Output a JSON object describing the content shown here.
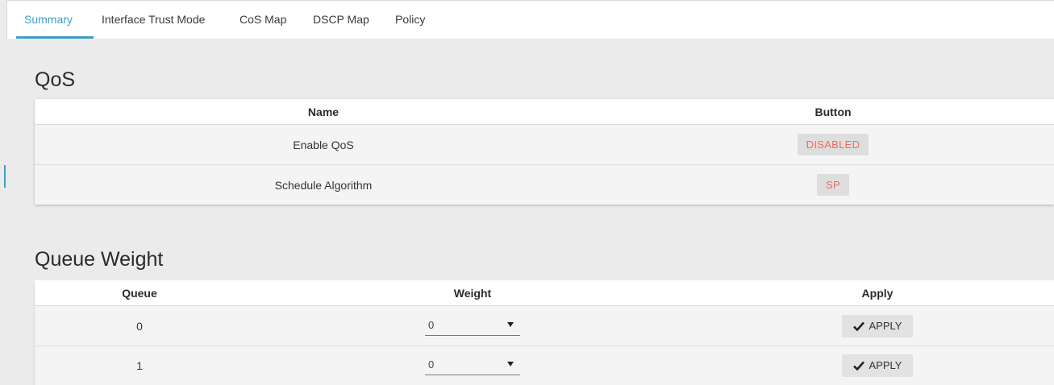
{
  "tabs": [
    {
      "label": "Summary",
      "active": true
    },
    {
      "label": "Interface Trust Mode",
      "active": false
    },
    {
      "label": "CoS Map",
      "active": false
    },
    {
      "label": "DSCP Map",
      "active": false
    },
    {
      "label": "Policy",
      "active": false
    }
  ],
  "qos": {
    "title": "QoS",
    "columns": {
      "name": "Name",
      "button": "Button"
    },
    "rows": [
      {
        "name": "Enable QoS",
        "button": "DISABLED"
      },
      {
        "name": "Schedule Algorithm",
        "button": "SP"
      }
    ]
  },
  "queue_weight": {
    "title": "Queue Weight",
    "columns": {
      "queue": "Queue",
      "weight": "Weight",
      "apply": "Apply"
    },
    "rows": [
      {
        "queue": "0",
        "weight": "0",
        "apply": "APPLY"
      },
      {
        "queue": "1",
        "weight": "0",
        "apply": "APPLY"
      }
    ]
  },
  "colors": {
    "accent": "#3aa0c9",
    "button_text_red": "#f06a5f",
    "background": "#ebebeb"
  },
  "icons": {
    "apply": "checkmark-icon",
    "dropdown": "caret-down-icon"
  }
}
